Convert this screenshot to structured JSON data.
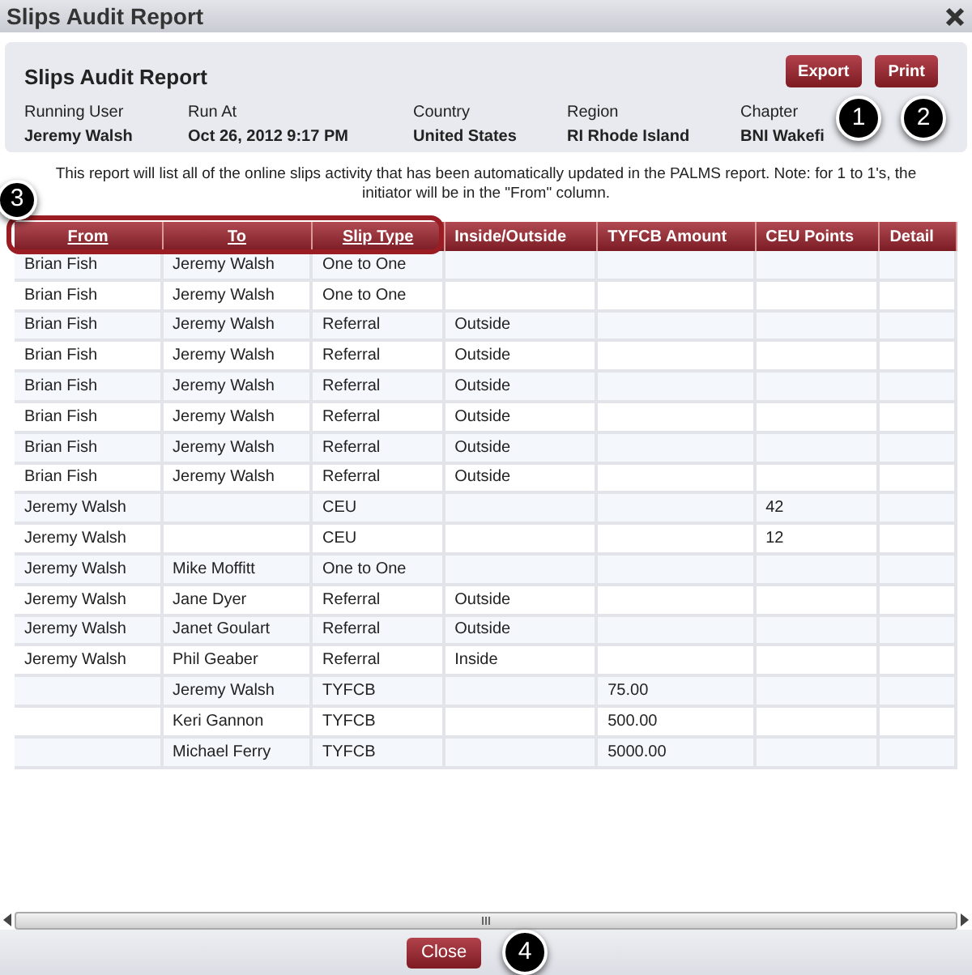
{
  "window": {
    "title": "Slips Audit Report"
  },
  "report": {
    "title": "Slips Audit Report",
    "buttons": [
      "Export",
      "Print"
    ],
    "fields": [
      {
        "label": "Running User",
        "value": "Jeremy Walsh"
      },
      {
        "label": "Run At",
        "value": "Oct 26, 2012 9:17 PM"
      },
      {
        "label": "Country",
        "value": "United States"
      },
      {
        "label": "Region",
        "value": "RI Rhode Island"
      },
      {
        "label": "Chapter",
        "value": "BNI Wakefi"
      }
    ]
  },
  "intro": "This report will list all of the online slips activity that has been automatically updated in the PALMS report.  Note: for 1 to 1's, the initiator will be in the \"From\" column.",
  "table": {
    "columns": [
      {
        "label": "From",
        "sortable": true
      },
      {
        "label": "To",
        "sortable": true
      },
      {
        "label": "Slip Type",
        "sortable": true
      },
      {
        "label": "Inside/Outside",
        "sortable": false
      },
      {
        "label": "TYFCB Amount",
        "sortable": false
      },
      {
        "label": "CEU Points",
        "sortable": false
      },
      {
        "label": "Detail",
        "sortable": false
      }
    ],
    "rows": [
      [
        "Brian Fish",
        "Jeremy Walsh",
        "One to One",
        "",
        "",
        "",
        ""
      ],
      [
        "Brian Fish",
        "Jeremy Walsh",
        "One to One",
        "",
        "",
        "",
        ""
      ],
      [
        "Brian Fish",
        "Jeremy Walsh",
        "Referral",
        "Outside",
        "",
        "",
        ""
      ],
      [
        "Brian Fish",
        "Jeremy Walsh",
        "Referral",
        "Outside",
        "",
        "",
        ""
      ],
      [
        "Brian Fish",
        "Jeremy Walsh",
        "Referral",
        "Outside",
        "",
        "",
        ""
      ],
      [
        "Brian Fish",
        "Jeremy Walsh",
        "Referral",
        "Outside",
        "",
        "",
        ""
      ],
      [
        "Brian Fish",
        "Jeremy Walsh",
        "Referral",
        "Outside",
        "",
        "",
        ""
      ],
      [
        "Brian Fish",
        "Jeremy Walsh",
        "Referral",
        "Outside",
        "",
        "",
        ""
      ],
      [
        "Jeremy Walsh",
        "",
        "CEU",
        "",
        "",
        "42",
        ""
      ],
      [
        "Jeremy Walsh",
        "",
        "CEU",
        "",
        "",
        "12",
        ""
      ],
      [
        "Jeremy Walsh",
        "Mike Moffitt",
        "One to One",
        "",
        "",
        "",
        ""
      ],
      [
        "Jeremy Walsh",
        "Jane Dyer",
        "Referral",
        "Outside",
        "",
        "",
        ""
      ],
      [
        "Jeremy Walsh",
        "Janet Goulart",
        "Referral",
        "Outside",
        "",
        "",
        ""
      ],
      [
        "Jeremy Walsh",
        "Phil Geaber",
        "Referral",
        "Inside",
        "",
        "",
        ""
      ],
      [
        "",
        "Jeremy Walsh",
        "TYFCB",
        "",
        "75.00",
        "",
        ""
      ],
      [
        "",
        "Keri Gannon",
        "TYFCB",
        "",
        "500.00",
        "",
        ""
      ],
      [
        "",
        "Michael Ferry",
        "TYFCB",
        "",
        "5000.00",
        "",
        ""
      ]
    ]
  },
  "footer": {
    "button": "Close"
  },
  "callouts": [
    "1",
    "2",
    "3",
    "4"
  ]
}
